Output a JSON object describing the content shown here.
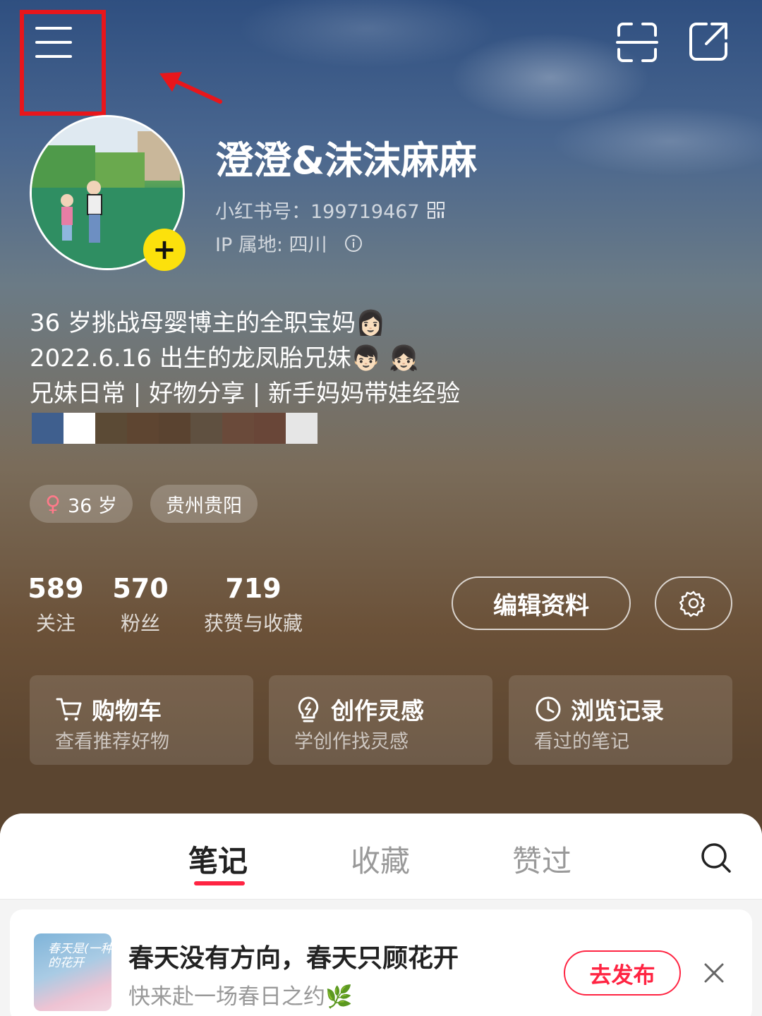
{
  "profile": {
    "nickname": "澄澄&沫沫麻麻",
    "red_id": "小红书号：199719467",
    "ip_location": "IP 属地: 四川",
    "bio_lines": [
      "36 岁挑战母婴博主的全职宝妈👩🏻",
      "2022.6.16 出生的龙凤胎兄妹👦🏻 👧🏻",
      "兄妹日常 | 好物分享 | 新手妈妈带娃经验"
    ],
    "tags": {
      "age": "36 岁",
      "location": "贵州贵阳"
    },
    "gender_symbol": "♀"
  },
  "stats": [
    {
      "num": "589",
      "label": "关注"
    },
    {
      "num": "570",
      "label": "粉丝"
    },
    {
      "num": "719",
      "label": "获赞与收藏"
    }
  ],
  "buttons": {
    "edit_profile": "编辑资料"
  },
  "cards": [
    {
      "title": "购物车",
      "sub": "查看推荐好物",
      "icon": "cart-icon"
    },
    {
      "title": "创作灵感",
      "sub": "学创作找灵感",
      "icon": "lightbulb-icon"
    },
    {
      "title": "浏览记录",
      "sub": "看过的笔记",
      "icon": "clock-icon"
    }
  ],
  "tabs": [
    "笔记",
    "收藏",
    "赞过"
  ],
  "draft": {
    "title": "春天没有方向，春天只顾花开",
    "sub": "快来赴一场春日之约🌿",
    "cover_text": "春天是(一种)\n的花开",
    "publish": "去发布"
  },
  "colors": {
    "accent": "#ff2442",
    "badge_yellow": "#fce10c",
    "annotation_red": "#e8161b"
  }
}
